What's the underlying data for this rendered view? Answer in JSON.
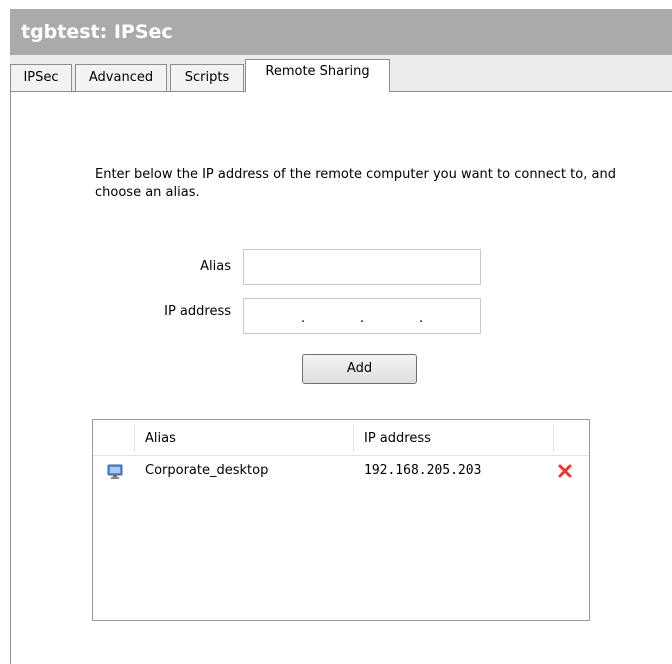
{
  "window": {
    "title": "tgbtest: IPSec"
  },
  "tabs": [
    {
      "label": "IPSec",
      "active": false
    },
    {
      "label": "Advanced",
      "active": false
    },
    {
      "label": "Scripts",
      "active": false
    },
    {
      "label": "Remote Sharing",
      "active": true
    }
  ],
  "form": {
    "instructions": "Enter below the IP address of the remote computer you want to connect to, and choose an alias.",
    "alias_label": "Alias",
    "alias_value": "",
    "ip_label": "IP address",
    "ip_value": [
      "",
      "",
      "",
      ""
    ],
    "ip_separator": ".",
    "add_button": "Add"
  },
  "list": {
    "columns": {
      "alias": "Alias",
      "ip": "IP address"
    },
    "rows": [
      {
        "icon": "monitor-icon",
        "alias": "Corporate_desktop",
        "ip": "192.168.205.203",
        "action_icon": "delete-icon"
      }
    ]
  },
  "colors": {
    "titlebar": "#aaaaaa",
    "delete": "#e53935"
  }
}
